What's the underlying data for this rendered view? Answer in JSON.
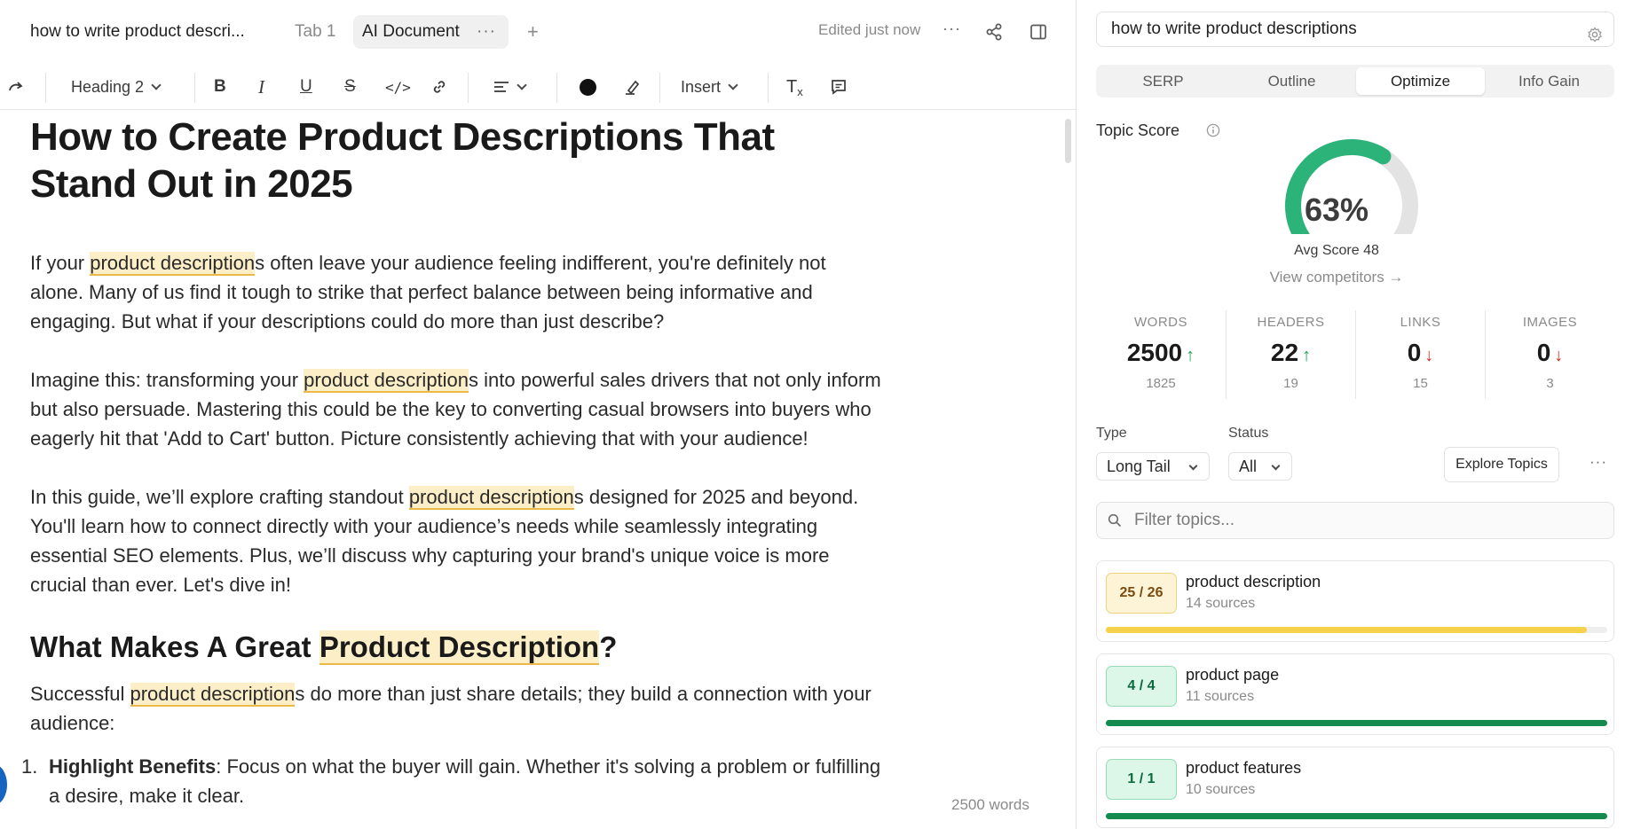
{
  "tabs": {
    "doc_title": "how to write product descri...",
    "tab1": "Tab 1",
    "ai_doc": "AI Document",
    "add": "+"
  },
  "header": {
    "edited": "Edited just now"
  },
  "toolbar": {
    "heading": "Heading 2",
    "insert": "Insert"
  },
  "doc": {
    "title": "How to Create Product Descriptions That Stand Out in 2025",
    "keyword": "product description",
    "p1_tail": "s often leave your audience feeling indifferent, you're definitely not alone. Many of us find it tough to strike that perfect balance between being informative and engaging. But what if your descriptions could do more than just describe?",
    "p1_head": "If your ",
    "p2_head": "Imagine this: transforming your ",
    "p2_tail": "s into powerful sales drivers that not only inform but also persuade. Mastering this could be the key to converting casual browsers into buyers who eagerly hit that 'Add to Cart' button. Picture consistently achieving that with your audience!",
    "p3_head": "In this guide, we’ll explore crafting standout ",
    "p3_tail": "s designed for 2025 and beyond. You'll learn how to connect directly with your audience’s needs while seamlessly integrating essential SEO elements. Plus, we’ll discuss why capturing your brand's unique voice is more crucial than ever. Let's dive in!",
    "h2_head": "What Makes A Great ",
    "h2_kw": "Product Description",
    "h2_tail": "?",
    "p4_head": "Successful ",
    "p4_tail": "s do more than just share details; they build a connection with your audience:",
    "li1_num": "1.",
    "li1_bold": "Highlight Benefits",
    "li1_text": ": Focus on what the buyer will gain. Whether it's solving a problem or fulfilling a desire, make it clear.",
    "word_count": "2500 words"
  },
  "side": {
    "query": "how to write product descriptions",
    "tabs": [
      "SERP",
      "Outline",
      "Optimize",
      "Info Gain"
    ],
    "active_tab": "Optimize",
    "topic_score_label": "Topic Score",
    "score": 63,
    "score_text": "63%",
    "avg_score": "Avg Score 48",
    "view_competitors": "View competitors →",
    "stats": [
      {
        "label": "WORDS",
        "value": "2500",
        "trend": "↑",
        "sub": "1825"
      },
      {
        "label": "HEADERS",
        "value": "22",
        "trend": "↑",
        "sub": "19"
      },
      {
        "label": "LINKS",
        "value": "0",
        "trend": "↓",
        "sub": "15"
      },
      {
        "label": "IMAGES",
        "value": "0",
        "trend": "↓",
        "sub": "3"
      }
    ],
    "type_label": "Type",
    "type_value": "Long Tail",
    "status_label": "Status",
    "status_value": "All",
    "explore": "Explore Topics",
    "filter_placeholder": "Filter topics...",
    "topics": [
      {
        "count": "25 / 26",
        "name": "product description",
        "sources": "14 sources",
        "progress": 0.96,
        "color": "#f5d24a",
        "style": "amber"
      },
      {
        "count": "4 / 4",
        "name": "product page",
        "sources": "11 sources",
        "progress": 1.0,
        "color": "#138a4e",
        "style": "green"
      },
      {
        "count": "1 / 1",
        "name": "product features",
        "sources": "10 sources",
        "progress": 1.0,
        "color": "#138a4e",
        "style": "green"
      }
    ]
  },
  "colors": {
    "gauge_fill": "#2bb37a",
    "gauge_track": "#e3e3e3",
    "highlight": "#fcefc7"
  }
}
